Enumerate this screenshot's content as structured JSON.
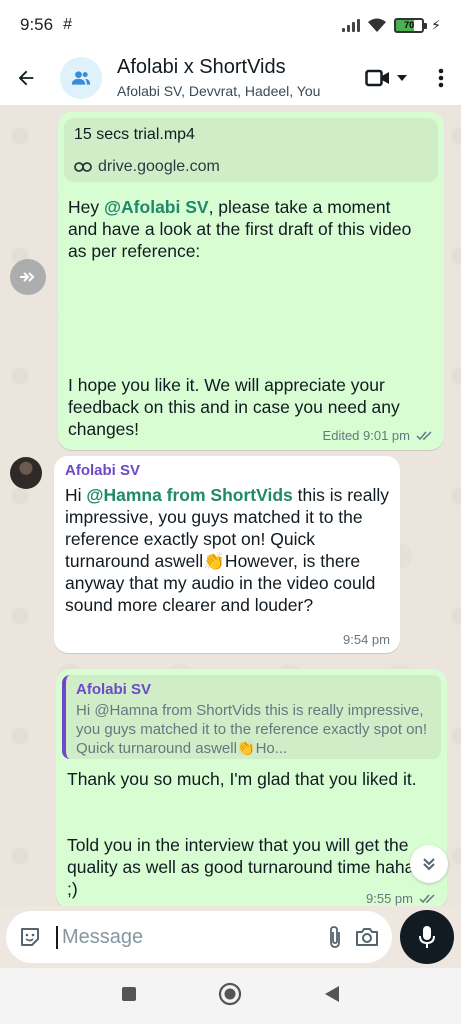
{
  "status_bar": {
    "time": "9:56",
    "battery": "70"
  },
  "header": {
    "title": "Afolabi x ShortVids",
    "subtitle": "Afolabi SV, Devvrat, Hadeel, You"
  },
  "messages": {
    "m1": {
      "link_file": "15 secs trial.mp4",
      "link_url": "drive.google.com",
      "text_before": "Hey ",
      "mention": "@Afolabi SV",
      "text_after": ", please take a moment and have a look at the first draft of this video as per reference:",
      "text_2": "I hope you like it. We will appreciate your feedback on this and in case you need any changes!",
      "meta": "Edited 9:01 pm"
    },
    "m2": {
      "sender": "Afolabi SV",
      "text_before": "Hi ",
      "mention": "@Hamna from ShortVids",
      "text_after": "  this is really impressive, you guys matched it to the reference exactly spot on! Quick turnaround aswell👏However, is there anyway that my audio in the video could sound more clearer and louder?",
      "time": "9:54 pm"
    },
    "m3": {
      "quote_name": "Afolabi SV",
      "quote_text": "Hi @Hamna from ShortVids  this is really impressive, you guys matched it to the reference exactly spot on! Quick turnaround aswell👏Ho...",
      "text_1": "Thank you so much, I'm glad that you liked it.",
      "text_2": "Told you in the interview that you will get the quality as well as good turnaround time haha ;)",
      "time": "9:55 pm"
    }
  },
  "input": {
    "placeholder": "Message"
  },
  "icons": {
    "back": "arrow-left-icon",
    "avatar": "group-icon",
    "video": "video-call-icon",
    "more": "more-vert-icon",
    "forward": "forward-icon",
    "link": "link-icon",
    "ticks": "double-check-icon",
    "scroll": "double-chevron-down-icon",
    "sticker": "sticker-icon",
    "attach": "paperclip-icon",
    "camera": "camera-icon",
    "mic": "microphone-icon"
  },
  "colors": {
    "outgoing_bubble": "#d9fdd3",
    "incoming_bubble": "#ffffff",
    "mention": "#1e8a6b",
    "sender_name": "#6e48c7",
    "read_ticks": "#667781"
  }
}
